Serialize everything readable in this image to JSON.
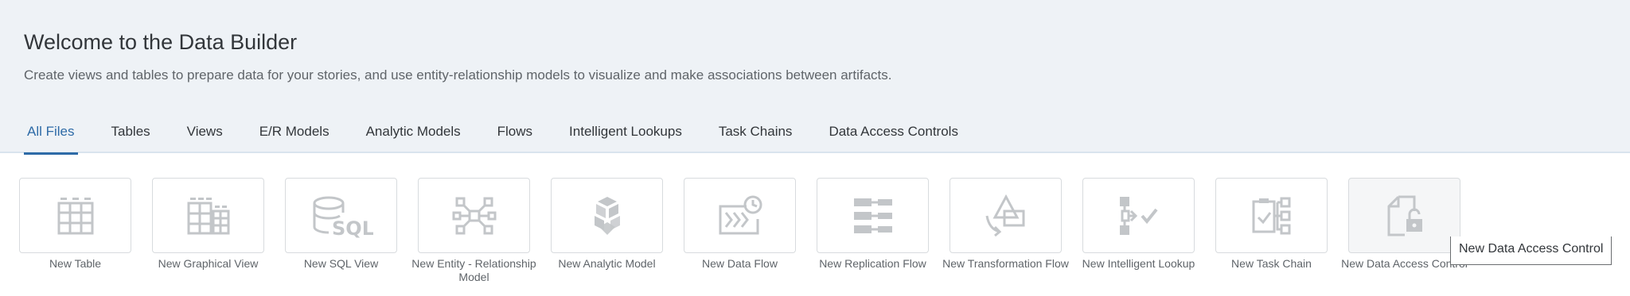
{
  "header": {
    "title": "Welcome to the Data Builder",
    "subtitle": "Create views and tables to prepare data for your stories, and use entity-relationship models to visualize and make associations between artifacts."
  },
  "tabs": [
    {
      "label": "All Files",
      "active": true
    },
    {
      "label": "Tables"
    },
    {
      "label": "Views"
    },
    {
      "label": "E/R Models"
    },
    {
      "label": "Analytic Models"
    },
    {
      "label": "Flows"
    },
    {
      "label": "Intelligent Lookups"
    },
    {
      "label": "Task Chains"
    },
    {
      "label": "Data Access Controls"
    }
  ],
  "tiles": [
    {
      "label": "New Table",
      "icon": "table-icon"
    },
    {
      "label": "New Graphical View",
      "icon": "graphical-view-icon"
    },
    {
      "label": "New SQL View",
      "icon": "sql-view-icon"
    },
    {
      "label": "New Entity - Relationship Model",
      "icon": "er-model-icon"
    },
    {
      "label": "New Analytic Model",
      "icon": "analytic-model-icon"
    },
    {
      "label": "New Data Flow",
      "icon": "data-flow-icon"
    },
    {
      "label": "New Replication Flow",
      "icon": "replication-flow-icon"
    },
    {
      "label": "New Transformation Flow",
      "icon": "transformation-flow-icon"
    },
    {
      "label": "New Intelligent Lookup",
      "icon": "intelligent-lookup-icon"
    },
    {
      "label": "New Task Chain",
      "icon": "task-chain-icon"
    },
    {
      "label": "New Data Access Control",
      "icon": "data-access-control-icon"
    }
  ],
  "tooltip": {
    "text": "New Data Access Control"
  },
  "colors": {
    "accent": "#2e6ba7",
    "header_bg": "#eef2f6",
    "icon": "#c3c6c9"
  }
}
